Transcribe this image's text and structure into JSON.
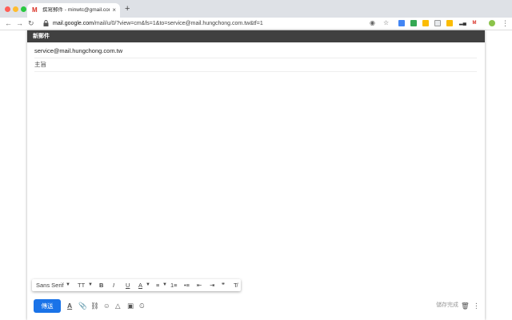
{
  "colors": {
    "tabstrip": "#dee1e6",
    "header": "#404040",
    "send": "#1a73e8",
    "close_dot": "#ff5f57",
    "min_dot": "#febc2e",
    "max_dot": "#28c840"
  },
  "tab": {
    "favicon": "M",
    "title": "撰寫郵件 - minwtc@gmail.com",
    "close": "×"
  },
  "new_tab": "+",
  "nav": {
    "back": "←",
    "forward": "→",
    "reload": "↻",
    "lock": "🔒"
  },
  "address": {
    "host": "mail.google.com",
    "path": "/mail/u/0/?view=cm&fs=1&to=service@mail.hungchong.com.tw&tf=1"
  },
  "toolbar_icons": [
    "eye-icon",
    "star-icon",
    "extension-icons"
  ],
  "compose": {
    "title": "新郵件",
    "to": "service@mail.hungchong.com.tw",
    "subject_placeholder": "主旨",
    "format_bar": {
      "font": "Sans Serif",
      "size": "TT",
      "bold": "B",
      "italic": "I",
      "underline": "U",
      "text_color": "A",
      "align": "≡",
      "numbered": "1≡",
      "bulleted": "•≡",
      "indent_less": "⇤",
      "indent_more": "⇥",
      "quote": "❞",
      "clear": "T̸"
    },
    "send": "傳送",
    "saved": "儲存完成"
  }
}
